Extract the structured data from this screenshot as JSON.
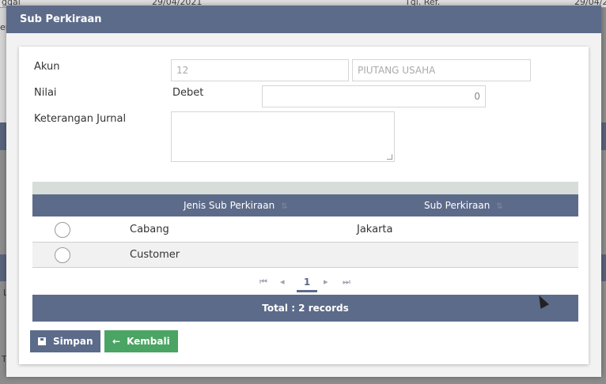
{
  "background": {
    "texts": [
      "ggal",
      "29/04/2021",
      "Tgl. Ref.",
      "29/04/2"
    ],
    "side_letters": [
      "er",
      "L",
      "T"
    ]
  },
  "modal": {
    "title": "Sub Perkiraan"
  },
  "form": {
    "akun_label": "Akun",
    "akun_code": "12",
    "akun_name": "PIUTANG USAHA",
    "nilai_label": "Nilai",
    "debet_label": "Debet",
    "nilai_value": "0",
    "keterangan_label": "Keterangan Jurnal",
    "keterangan_value": ""
  },
  "grid": {
    "columns": [
      "Jenis Sub Perkiraan",
      "Sub Perkiraan"
    ],
    "sort_icon": "⇅",
    "rows": [
      {
        "jenis": "Cabang",
        "sub": "Jakarta"
      },
      {
        "jenis": "Customer",
        "sub": ""
      }
    ],
    "pager": {
      "first": "⏮",
      "prev": "◂",
      "page": "1",
      "next": "▸",
      "last": "⏭"
    },
    "total_text": "Total : 2 records"
  },
  "buttons": {
    "save_label": "Simpan",
    "back_label": "Kembali",
    "back_icon": "←"
  },
  "colors": {
    "header": "#5d6b8a",
    "save": "#5d6b8a",
    "back": "#4aa463"
  }
}
